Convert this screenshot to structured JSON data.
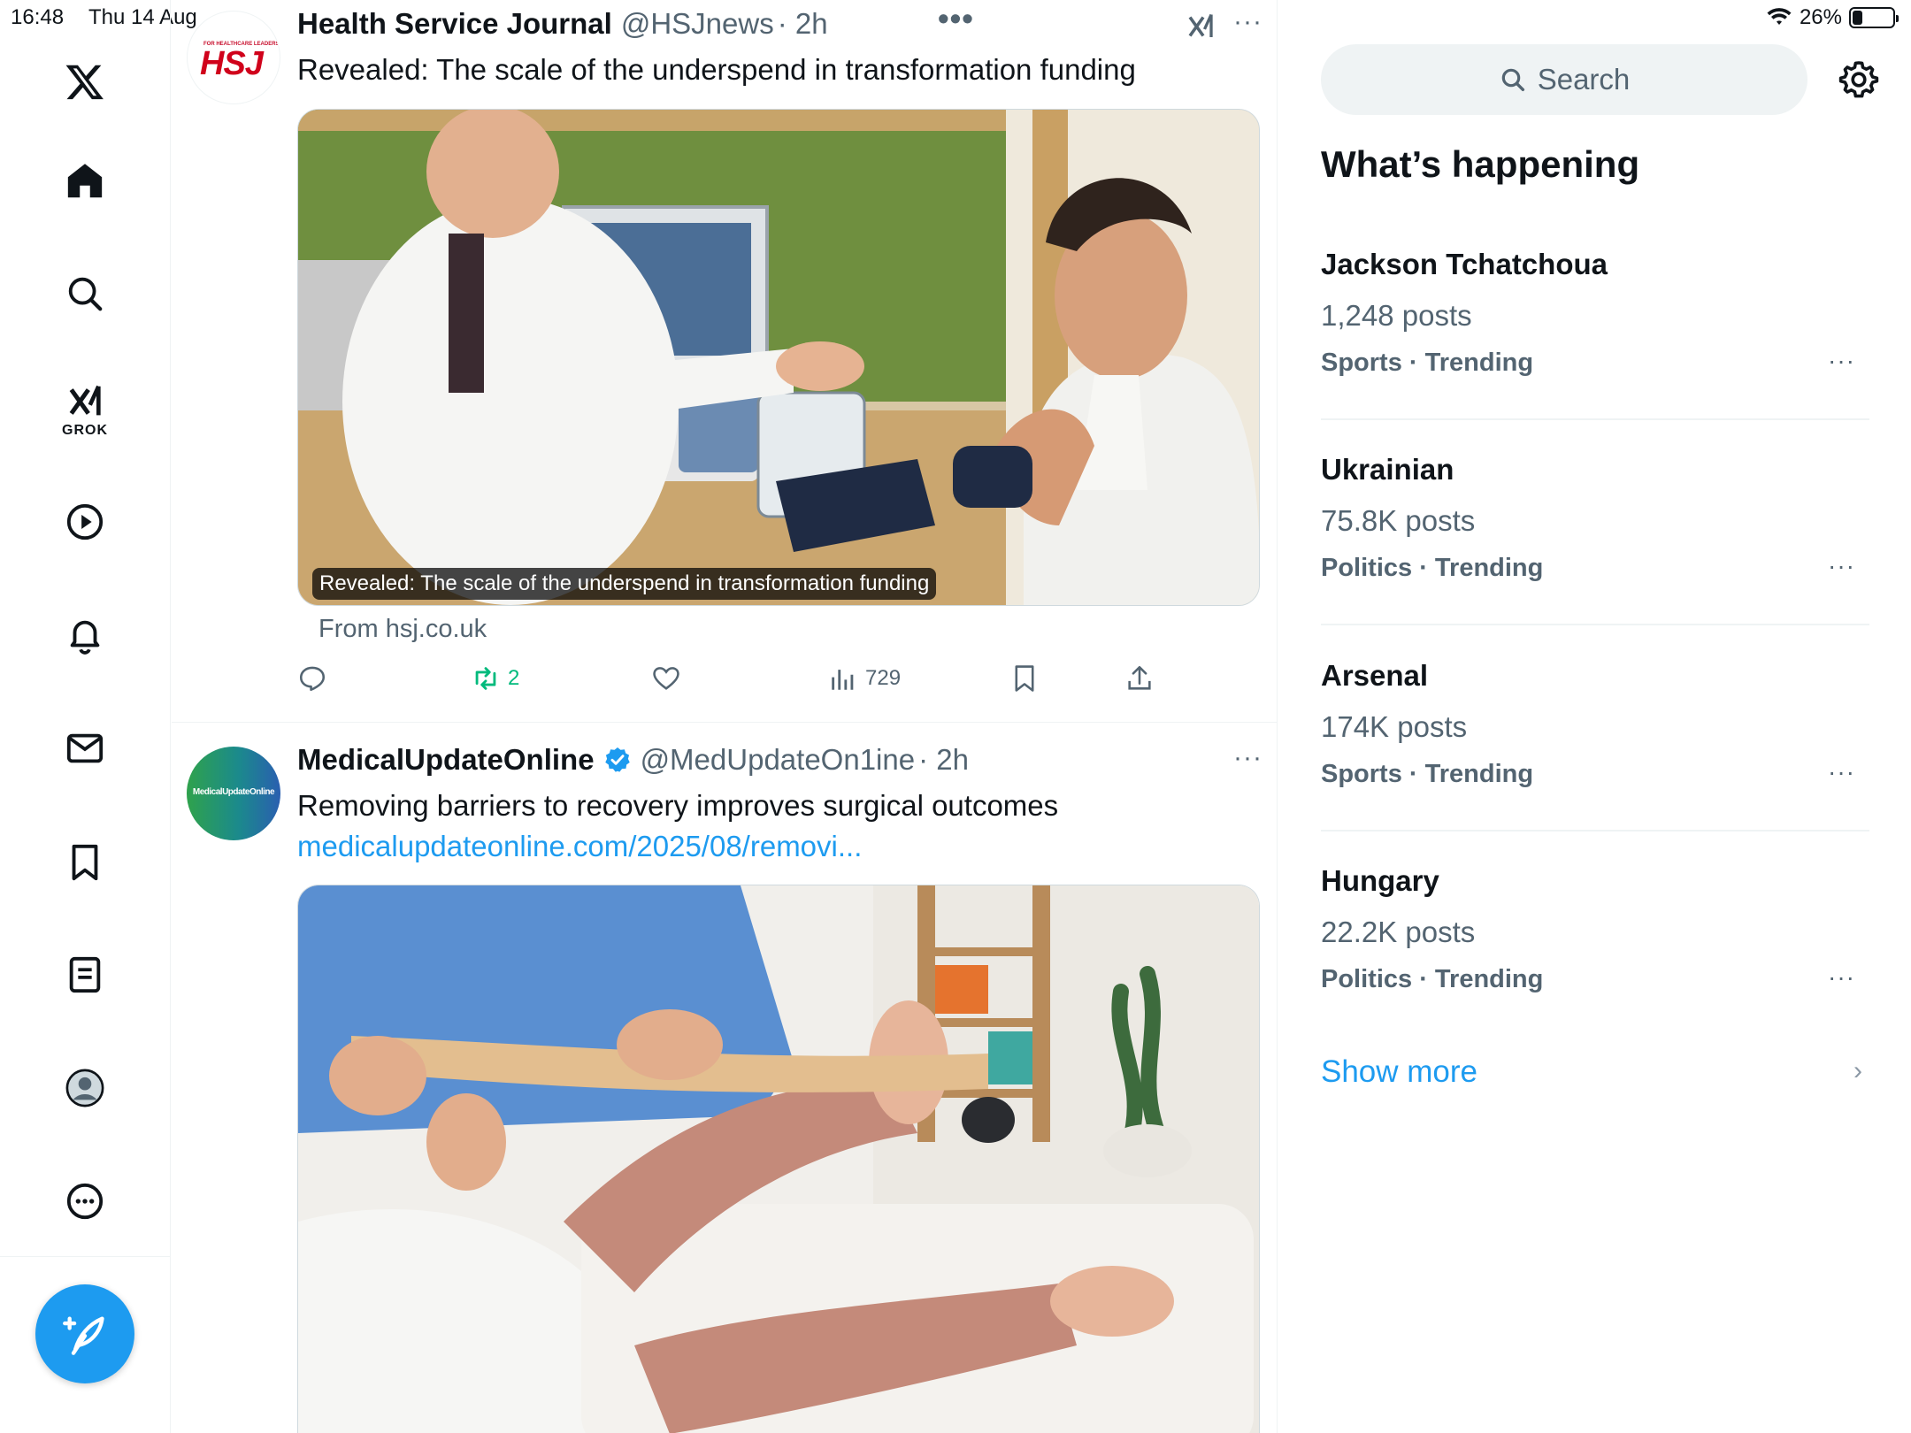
{
  "status_bar": {
    "time": "16:48",
    "date": "Thu 14 Aug",
    "battery": "26%",
    "battery_level": 0.26
  },
  "nav": {
    "items": [
      "x-logo-icon",
      "home-icon",
      "search-icon",
      "grok-icon",
      "video-icon",
      "notifications-icon",
      "messages-icon",
      "bookmarks-icon",
      "lists-icon",
      "profile-icon",
      "more-icon"
    ],
    "grok_label": "GROK",
    "compose": "compose-icon"
  },
  "feed": {
    "tweets": [
      {
        "name": "Health Service Journal",
        "handle": "@HSJnews",
        "time": "· 2h",
        "avatar_text": "HSJ",
        "avatar_subtext": "FOR HEALTHCARE LEADERS",
        "text": "Revealed: The scale of the underspend in transformation funding",
        "media_caption": "Revealed: The scale of the underspend in transformation funding",
        "source": "From hsj.co.uk",
        "actions": {
          "reply": "",
          "retweets": "2",
          "likes": "",
          "views": "729"
        }
      },
      {
        "name": "MedicalUpdateOnline",
        "handle": "@MedUpdateOn1ine",
        "time": "· 2h",
        "verified": true,
        "avatar_text": "MedicalUpdateOnline",
        "text": "Removing barriers to recovery improves surgical outcomes",
        "link": "medicalupdateonline.com/2025/08/removi..."
      }
    ]
  },
  "right": {
    "search_placeholder": "Search",
    "section_title": "What’s happening",
    "trends": [
      {
        "name": "Jackson Tchatchoua",
        "posts": "1,248 posts",
        "category": "Sports · Trending"
      },
      {
        "name": "Ukrainian",
        "posts": "75.8K posts",
        "category": "Politics · Trending"
      },
      {
        "name": "Arsenal",
        "posts": "174K posts",
        "category": "Sports · Trending"
      },
      {
        "name": "Hungary",
        "posts": "22.2K posts",
        "category": "Politics · Trending"
      }
    ],
    "show_more": "Show more",
    "colors": {
      "accent": "#1d9bf0",
      "muted": "#536471",
      "retweet": "#00ba7c"
    }
  }
}
